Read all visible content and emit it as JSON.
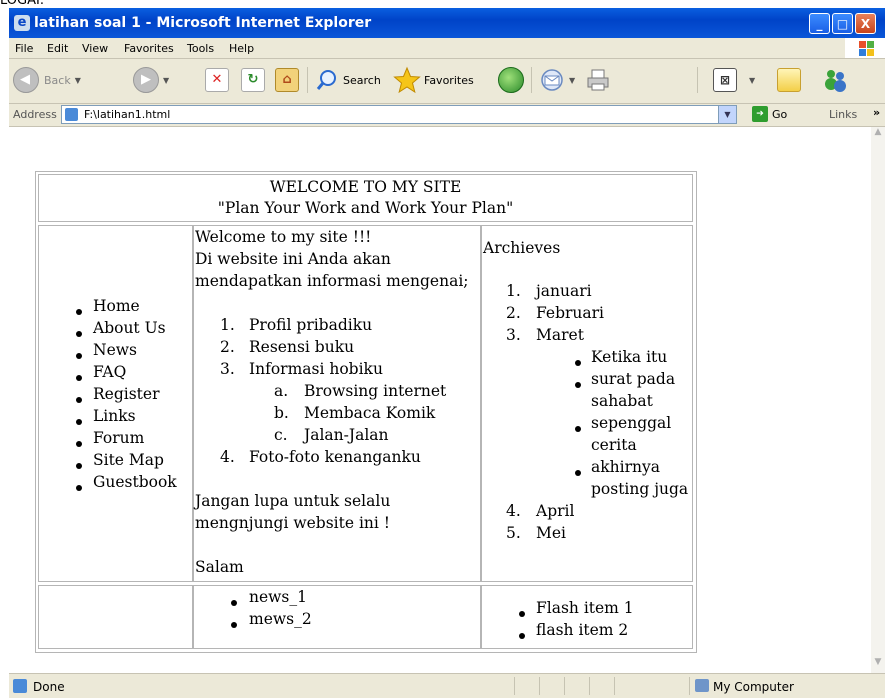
{
  "cropped_top_text": "LOGAI.",
  "window": {
    "title": "latihan soal 1 - Microsoft Internet Explorer",
    "controls": [
      "_",
      "□",
      "X"
    ]
  },
  "menu": [
    "File",
    "Edit",
    "View",
    "Favorites",
    "Tools",
    "Help"
  ],
  "toolbar": {
    "back_label": "Back",
    "search_label": "Search",
    "favorites_label": "Favorites"
  },
  "address": {
    "label": "Address",
    "value": "F:\\latihan1.html",
    "go_label": "Go",
    "links_label": "Links",
    "more": "»"
  },
  "page": {
    "header": {
      "title": "WELCOME TO MY SITE",
      "subtitle": "\"Plan Your Work and Work Your Plan\""
    },
    "nav": [
      "Home",
      "About Us",
      "News",
      "FAQ",
      "Register",
      "Links",
      "Forum",
      "Site Map",
      "Guestbook"
    ],
    "main": {
      "intro_lines": [
        "Welcome to my site !!!",
        "Di website ini Anda akan",
        "mendapatkan informasi mengenai;"
      ],
      "list": [
        {
          "num": "1.",
          "text": "Profil pribadiku"
        },
        {
          "num": "2.",
          "text": "Resensi buku"
        },
        {
          "num": "3.",
          "text": "Informasi hobiku"
        },
        {
          "num": "4.",
          "text": "Foto-foto kenanganku"
        }
      ],
      "sublist": [
        {
          "num": "a.",
          "text": "Browsing internet"
        },
        {
          "num": "b.",
          "text": "Membaca Komik"
        },
        {
          "num": "c.",
          "text": "Jalan-Jalan"
        }
      ],
      "closing_lines": [
        "Jangan lupa untuk selalu",
        "mengnjungi website ini !"
      ],
      "signoff": "Salam"
    },
    "archives": {
      "title": "Archieves",
      "months": [
        {
          "num": "1.",
          "text": "januari"
        },
        {
          "num": "2.",
          "text": "Februari"
        },
        {
          "num": "3.",
          "text": "Maret"
        },
        {
          "num": "4.",
          "text": "April"
        },
        {
          "num": "5.",
          "text": "Mei"
        }
      ],
      "maret_items": [
        "Ketika itu",
        "surat pada",
        "sahabat",
        "sepenggal",
        "cerita",
        "akhirnya",
        "posting juga"
      ]
    },
    "news": [
      "news_1",
      "mews_2"
    ],
    "flash": [
      "Flash item 1",
      "flash item 2"
    ]
  },
  "status": {
    "text": "Done",
    "zone": "My Computer"
  }
}
